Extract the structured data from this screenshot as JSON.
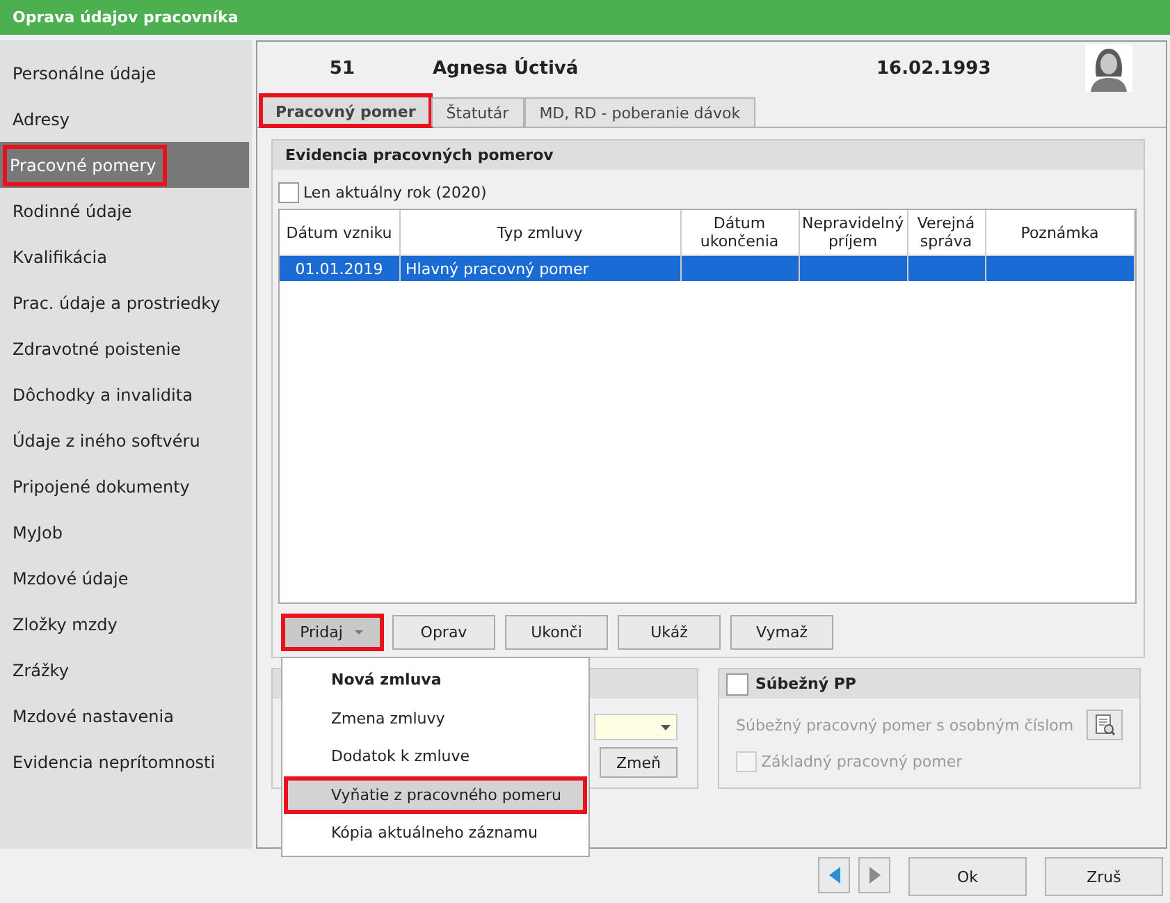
{
  "window": {
    "title": "Oprava údajov pracovníka"
  },
  "sidebar": {
    "items": [
      {
        "label": "Personálne údaje",
        "selected": false,
        "highlighted": false
      },
      {
        "label": "Adresy",
        "selected": false,
        "highlighted": false
      },
      {
        "label": "Pracovné pomery",
        "selected": true,
        "highlighted": true
      },
      {
        "label": "Rodinné údaje",
        "selected": false,
        "highlighted": false
      },
      {
        "label": "Kvalifikácia",
        "selected": false,
        "highlighted": false
      },
      {
        "label": "Prac. údaje a prostriedky",
        "selected": false,
        "highlighted": false
      },
      {
        "label": "Zdravotné poistenie",
        "selected": false,
        "highlighted": false
      },
      {
        "label": "Dôchodky a invalidita",
        "selected": false,
        "highlighted": false
      },
      {
        "label": "Údaje z iného softvéru",
        "selected": false,
        "highlighted": false
      },
      {
        "label": "Pripojené dokumenty",
        "selected": false,
        "highlighted": false
      },
      {
        "label": "MyJob",
        "selected": false,
        "highlighted": false
      },
      {
        "label": "Mzdové údaje",
        "selected": false,
        "highlighted": false
      },
      {
        "label": "Zložky mzdy",
        "selected": false,
        "highlighted": false
      },
      {
        "label": "Zrážky",
        "selected": false,
        "highlighted": false
      },
      {
        "label": "Mzdové nastavenia",
        "selected": false,
        "highlighted": false
      },
      {
        "label": "Evidencia neprítomnosti",
        "selected": false,
        "highlighted": false
      }
    ]
  },
  "employee": {
    "number": "51",
    "name": "Agnesa Úctivá",
    "date": "16.02.1993"
  },
  "tabs": [
    {
      "label": "Pracovný pomer",
      "selected": true,
      "highlighted": true
    },
    {
      "label": "Štatutár",
      "selected": false,
      "highlighted": false
    },
    {
      "label": "MD, RD - poberanie dávok",
      "selected": false,
      "highlighted": false
    }
  ],
  "records": {
    "title": "Evidencia pracovných pomerov",
    "filter": {
      "label": "Len aktuálny rok (2020)",
      "checked": false
    },
    "table": {
      "columns": [
        "Dátum vzniku",
        "Typ zmluvy",
        "Dátum ukončenia",
        "Nepravidelný príjem",
        "Verejná správa",
        "Poznámka"
      ],
      "rows": [
        {
          "cells": [
            "01.01.2019",
            "Hlavný pracovný pomer",
            "",
            "",
            "",
            ""
          ],
          "selected": true
        }
      ]
    },
    "buttons": [
      {
        "label": "Pridaj",
        "kind": "dropdown",
        "highlighted": true
      },
      {
        "label": "Oprav",
        "kind": "plain",
        "highlighted": false
      },
      {
        "label": "Ukonči",
        "kind": "plain",
        "highlighted": false
      },
      {
        "label": "Ukáž",
        "kind": "plain",
        "highlighted": false
      },
      {
        "label": "Vymaž",
        "kind": "plain",
        "highlighted": false
      }
    ]
  },
  "left_group": {
    "button": "Zmeň"
  },
  "concurrent": {
    "title": "Súbežný PP",
    "checked": false,
    "text": "Súbežný pracovný pomer s osobným číslom",
    "basic": {
      "label": "Základný pracovný pomer",
      "checked": false,
      "disabled": true
    }
  },
  "menu": {
    "items": [
      {
        "label": "Nová zmluva",
        "bold": true,
        "highlighted": false
      },
      {
        "label": "Zmena zmluvy",
        "bold": false,
        "highlighted": false
      },
      {
        "label": "Dodatok k zmluve",
        "bold": false,
        "highlighted": false
      },
      {
        "label": "Vyňatie z pracovného pomeru",
        "bold": false,
        "highlighted": true
      },
      {
        "label": "Kópia aktuálneho záznamu",
        "bold": false,
        "highlighted": false
      }
    ]
  },
  "footer": {
    "buttons": [
      "Ok",
      "Zruš"
    ]
  }
}
